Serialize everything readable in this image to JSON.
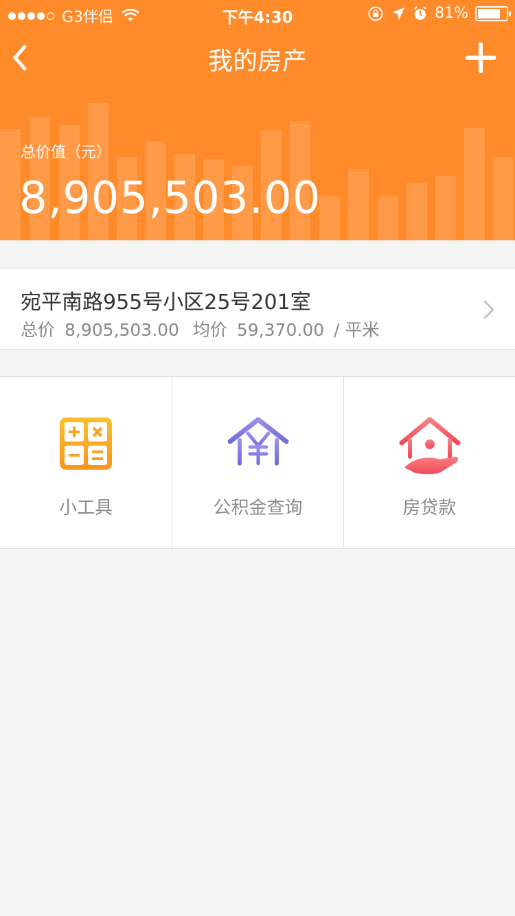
{
  "status_bar": {
    "carrier": "G3伴侣",
    "time": "下午4:30",
    "battery_text": "81%",
    "battery_level": 0.81,
    "signal_bars": 4,
    "signal_total": 5
  },
  "nav": {
    "title": "我的房产",
    "back_icon": "chevron-left-icon",
    "add_icon": "plus-icon"
  },
  "summary": {
    "total_label": "总价值（元）",
    "total_value": "8,905,503.00"
  },
  "property": {
    "name": "宛平南路955号小区25号201室",
    "total_label": "总价",
    "total_value": "8,905,503.00",
    "avg_label": "均价",
    "avg_value": "59,370.00",
    "unit": "/ 平米"
  },
  "tools": [
    {
      "label": "小工具",
      "icon": "calculator-icon"
    },
    {
      "label": "公积金查询",
      "icon": "housing-fund-icon"
    },
    {
      "label": "房贷款",
      "icon": "mortgage-house-icon"
    }
  ],
  "colors": {
    "accent": "#ff8a2a",
    "calculator": "#f8a21d",
    "fund": "#8a7be0",
    "mortgage": "#f4666e"
  }
}
